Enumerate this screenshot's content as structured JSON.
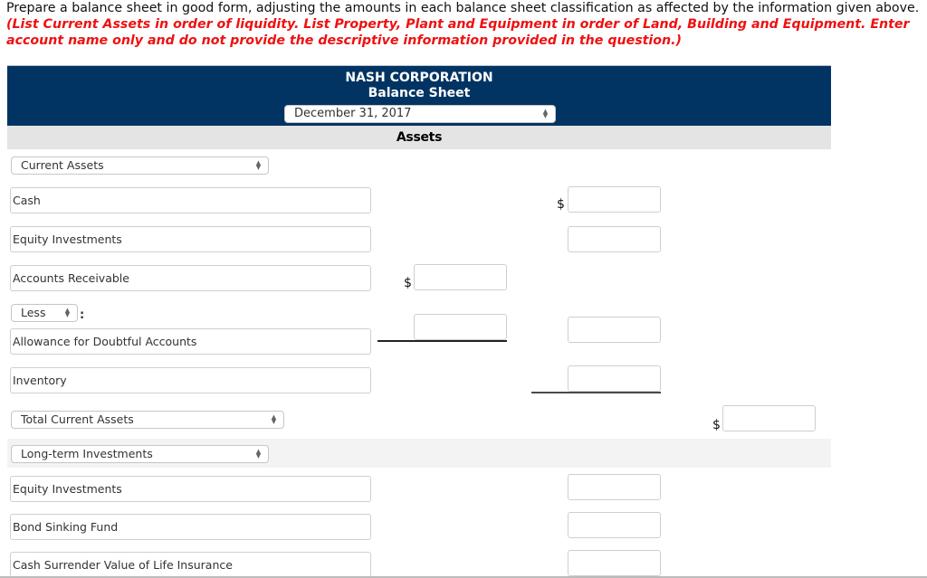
{
  "instructions": {
    "text": "Prepare a balance sheet in good form, adjusting the amounts in each balance sheet classification as affected by the information given above. ",
    "emphasis": "(List Current Assets in order of liquidity. List Property, Plant and Equipment in order of Land, Building and Equipment. Enter account name only and do not provide the descriptive information provided in the question.)"
  },
  "header": {
    "company": "NASH CORPORATION",
    "title": "Balance Sheet",
    "date_selected": "December 31, 2017",
    "section": "Assets"
  },
  "colors": {
    "header_bg": "#023463",
    "section_bar": "#e4e4e4",
    "emphasis_text": "#ee1111"
  },
  "rows": {
    "current_assets_select": "Current Assets",
    "cash": "Cash",
    "equity_investments_current": "Equity Investments",
    "accounts_receivable": "Accounts Receivable",
    "less_select": "Less",
    "colon": ":",
    "allowance": "Allowance for Doubtful Accounts",
    "inventory": "Inventory",
    "total_current_assets_select": "Total Current Assets",
    "long_term_investments_select": "Long-term Investments",
    "equity_investments_long": "Equity Investments",
    "bond_sinking_fund": "Bond Sinking Fund",
    "cash_surrender_value": "Cash Surrender Value of Life Insurance"
  },
  "amounts": {
    "cash": "",
    "equity_investments_current": "",
    "accounts_receivable": "",
    "allowance": "",
    "net_receivables": "",
    "inventory": "",
    "total_current_assets": "",
    "equity_investments_long": "",
    "bond_sinking_fund": "",
    "cash_surrender_value": ""
  },
  "currency_symbol": "$"
}
